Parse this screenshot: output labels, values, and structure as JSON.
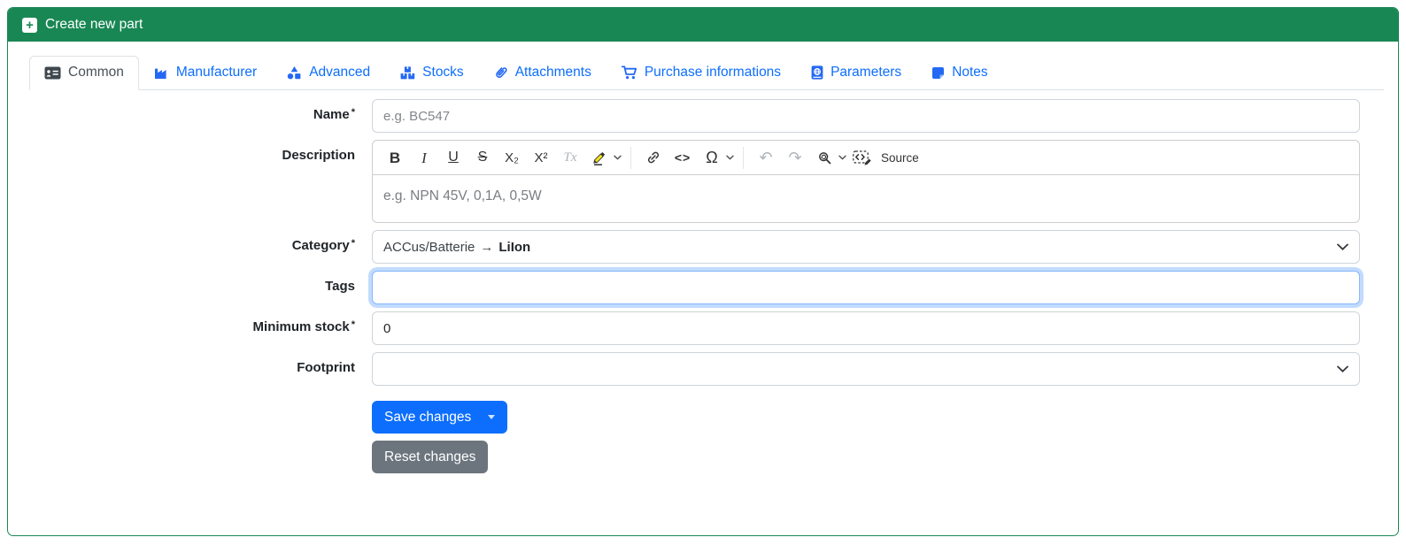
{
  "colors": {
    "header_green": "#198754",
    "primary_blue": "#0d6efd",
    "secondary_grey": "#6c757d",
    "tab_active_text": "#495057",
    "focus_ring": "rgba(13,110,253,.25)"
  },
  "header": {
    "title": "Create new part",
    "icon": "plus-square-icon"
  },
  "tabs": [
    {
      "label": "Common",
      "icon": "id-card-icon",
      "active": true
    },
    {
      "label": "Manufacturer",
      "icon": "factory-icon",
      "active": false
    },
    {
      "label": "Advanced",
      "icon": "shapes-icon",
      "active": false
    },
    {
      "label": "Stocks",
      "icon": "boxes-icon",
      "active": false
    },
    {
      "label": "Attachments",
      "icon": "paperclip-icon",
      "active": false
    },
    {
      "label": "Purchase informations",
      "icon": "shopping-cart-icon",
      "active": false
    },
    {
      "label": "Parameters",
      "icon": "book-atlas-icon",
      "active": false
    },
    {
      "label": "Notes",
      "icon": "sticky-note-icon",
      "active": false
    }
  ],
  "form": {
    "required_marker": "*",
    "name": {
      "label": "Name",
      "required": true,
      "placeholder": "e.g. BC547",
      "value": ""
    },
    "description": {
      "label": "Description",
      "required": false,
      "placeholder": "e.g. NPN 45V, 0,1A, 0,5W",
      "value": ""
    },
    "category": {
      "label": "Category",
      "required": true,
      "value_parent": "ACCus/Batterie",
      "value_arrow": "→",
      "value_selected": "LiIon"
    },
    "tags": {
      "label": "Tags",
      "required": false,
      "value": "",
      "focused": true
    },
    "minimum_stock": {
      "label": "Minimum stock",
      "required": true,
      "value": "0"
    },
    "footprint": {
      "label": "Footprint",
      "required": false,
      "value": ""
    }
  },
  "editor_toolbar": {
    "items": [
      {
        "name": "bold",
        "glyph": "B"
      },
      {
        "name": "italic",
        "glyph": "I"
      },
      {
        "name": "underline",
        "glyph": "U"
      },
      {
        "name": "strikethrough",
        "glyph": "S"
      },
      {
        "name": "subscript",
        "glyph": "X₂"
      },
      {
        "name": "superscript",
        "glyph": "X²"
      },
      {
        "name": "remove-format",
        "glyph": "Tx",
        "disabled": true
      },
      {
        "name": "highlight",
        "glyph": "",
        "has_dropdown": true
      },
      {
        "name": "link",
        "glyph": ""
      },
      {
        "name": "code",
        "glyph": "<>"
      },
      {
        "name": "special-characters",
        "glyph": "Ω",
        "has_dropdown": true
      },
      {
        "name": "undo",
        "glyph": "↶",
        "disabled": true
      },
      {
        "name": "redo",
        "glyph": "↷",
        "disabled": true
      },
      {
        "name": "find-and-replace",
        "glyph": "",
        "has_dropdown": true
      },
      {
        "name": "source",
        "glyph": "",
        "label": "Source"
      }
    ],
    "source_label": "Source"
  },
  "buttons": {
    "save": "Save changes",
    "reset": "Reset changes"
  }
}
